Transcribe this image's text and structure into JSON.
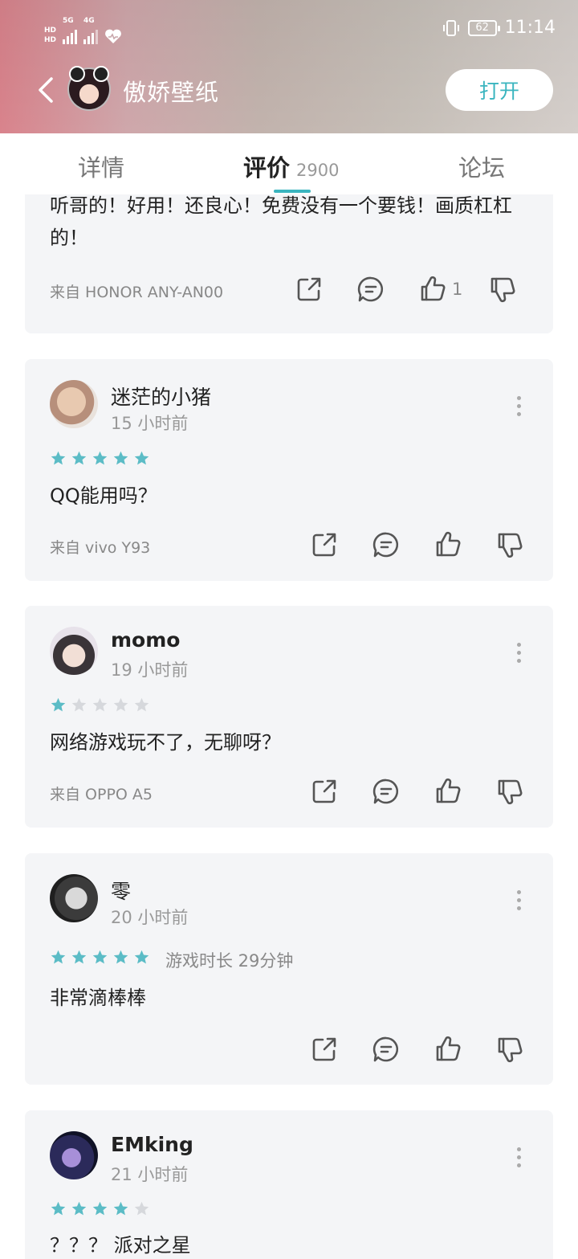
{
  "status_bar": {
    "time": "11:14",
    "battery": "62",
    "sim1_tag": "5G",
    "sim2_tag": "4G",
    "hd1": "HD",
    "hd2": "HD"
  },
  "app": {
    "title": "傲娇壁纸",
    "open_label": "打开"
  },
  "tabs": [
    {
      "label": "详情"
    },
    {
      "label": "评价",
      "count": "2900"
    },
    {
      "label": "论坛"
    }
  ],
  "reviews": [
    {
      "content": "听哥的！好用！还良心！免费没有一个要钱！画质杠杠的！",
      "device": "来自 HONOR ANY-AN00",
      "likes": "1"
    },
    {
      "user": "迷茫的小猪",
      "time": "15 小时前",
      "rating": 5,
      "content": "QQ能用吗？",
      "device": "来自 vivo Y93"
    },
    {
      "user": "momo",
      "time": "19 小时前",
      "rating": 1,
      "content": "网络游戏玩不了，无聊呀？",
      "device": "来自 OPPO A5"
    },
    {
      "user": "零",
      "time": "20 小时前",
      "rating": 5,
      "playtime": "游戏时长 29分钟",
      "content": "非常滴棒棒",
      "device": ""
    },
    {
      "user": "EMking",
      "time": "21 小时前",
      "rating": 4,
      "content": "？？？ 派对之星"
    }
  ],
  "colors": {
    "accent": "#3ab5bf",
    "star_on": "#5bbcc6",
    "star_off": "#d6d8dc",
    "card_bg": "#f4f5f7"
  },
  "icons": [
    "back-icon",
    "share-icon",
    "comment-icon",
    "like-icon",
    "dislike-icon",
    "more-icon",
    "star-icon",
    "vibrate-icon",
    "wifi-signal-icon",
    "heart-icon"
  ]
}
